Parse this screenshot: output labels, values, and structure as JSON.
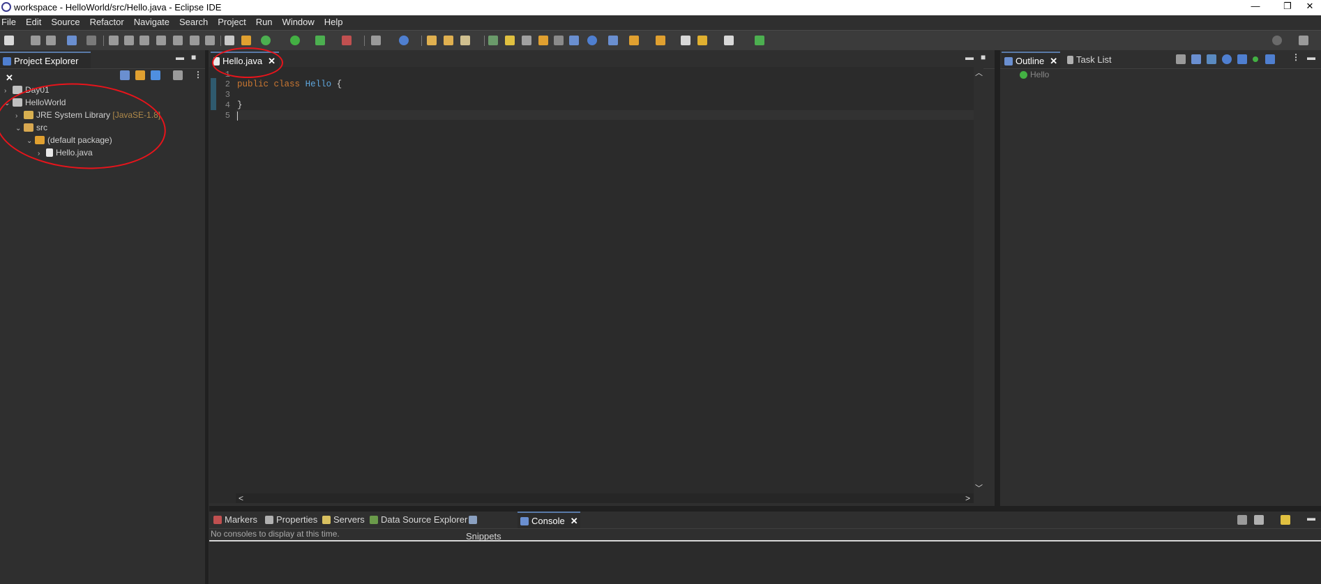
{
  "window": {
    "title": "workspace - HelloWorld/src/Hello.java - Eclipse IDE",
    "minimize_glyph": "—",
    "restore_glyph": "❐",
    "close_glyph": "✕"
  },
  "menu": [
    "File",
    "Edit",
    "Source",
    "Refactor",
    "Navigate",
    "Search",
    "Project",
    "Run",
    "Window",
    "Help"
  ],
  "project_explorer": {
    "tab_label": "Project Explorer",
    "tree": [
      {
        "label": "Day01",
        "icon": "project-icon",
        "expanded": false,
        "depth": 0
      },
      {
        "label": "HelloWorld",
        "icon": "project-icon",
        "expanded": true,
        "depth": 0
      },
      {
        "label": "JRE System Library",
        "decoration": "[JavaSE-1.8]",
        "icon": "library-icon",
        "expanded": false,
        "depth": 1
      },
      {
        "label": "src",
        "icon": "source-folder-icon",
        "expanded": true,
        "depth": 1
      },
      {
        "label": "(default package)",
        "icon": "package-icon",
        "expanded": true,
        "depth": 2
      },
      {
        "label": "Hello.java",
        "icon": "java-file-icon",
        "expanded": false,
        "depth": 3
      }
    ]
  },
  "editor": {
    "tab_label": "Hello.java",
    "line_numbers": [
      "1",
      "2",
      "3",
      "4",
      "5"
    ],
    "code": {
      "kw_public": "public",
      "kw_class": "class",
      "class_name": "Hello",
      "brace_open": "{",
      "brace_close": "}"
    },
    "scroll_left": "<",
    "scroll_right": ">"
  },
  "outline": {
    "tab_outline": "Outline",
    "tab_tasklist": "Task List",
    "items": [
      {
        "label": "Hello",
        "icon": "class-icon"
      }
    ]
  },
  "bottom": {
    "tabs": [
      "Markers",
      "Properties",
      "Servers",
      "Data Source Explorer",
      "Snippets",
      "Console"
    ],
    "active_tab": "Console",
    "console_message": "No consoles to display at this time."
  },
  "colors": {
    "background": "#2f2f2f",
    "editor_bg": "#2b2b2b",
    "keyword": "#cc7832",
    "class_name": "#5ea6dc",
    "annotation_red": "#e8141b"
  }
}
